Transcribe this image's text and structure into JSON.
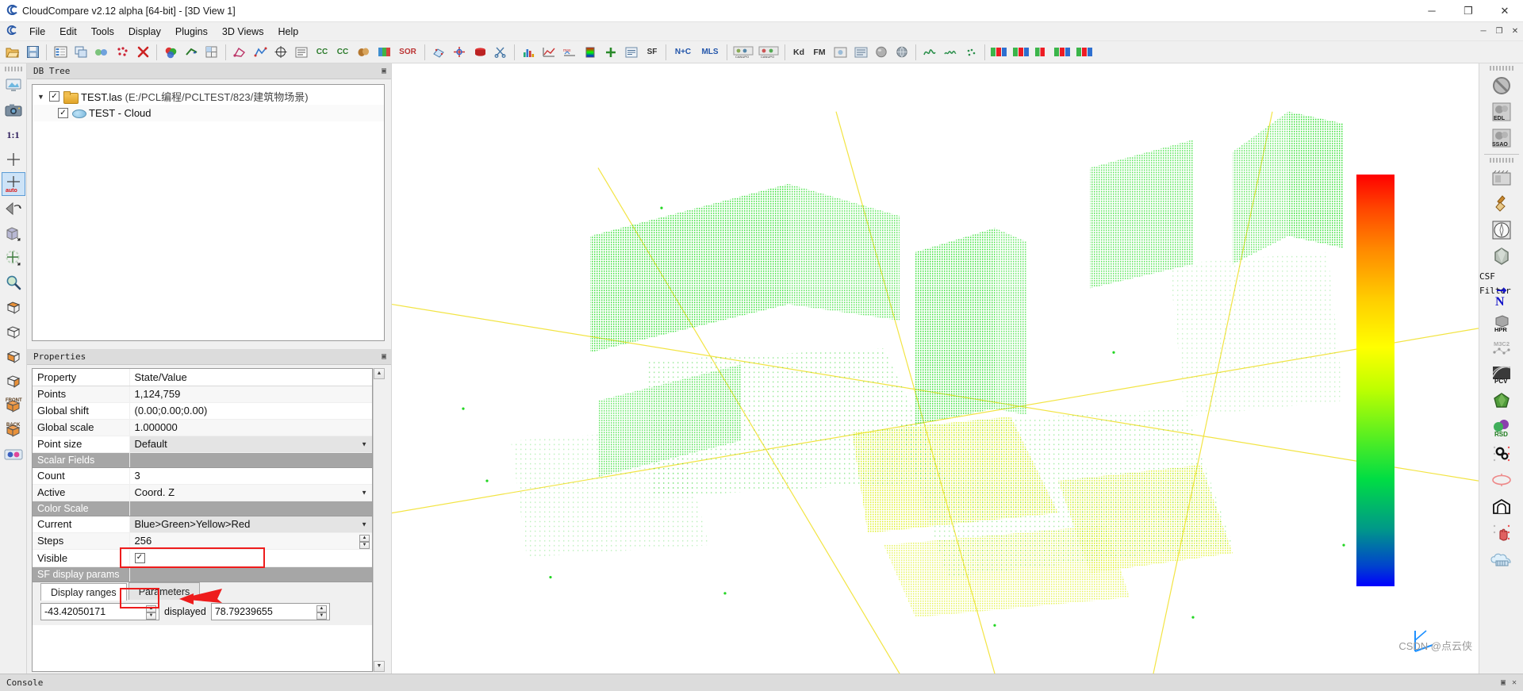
{
  "window": {
    "title": "CloudCompare v2.12 alpha [64-bit] - [3D View 1]",
    "app_icon": "cloudcompare-icon",
    "minimize": "─",
    "maximize": "❐",
    "close": "✕",
    "inner_minimize": "─",
    "inner_restore": "❐",
    "inner_close": "✕"
  },
  "menu": {
    "icon": "cloudcompare-icon",
    "items": [
      {
        "label": "File"
      },
      {
        "label": "Edit"
      },
      {
        "label": "Tools"
      },
      {
        "label": "Display"
      },
      {
        "label": "Plugins"
      },
      {
        "label": "3D Views"
      },
      {
        "label": "Help"
      }
    ]
  },
  "toolbar": {
    "groups": [
      {
        "buttons": [
          {
            "name": "open-file-icon",
            "glyph": "📂"
          },
          {
            "name": "save-file-icon",
            "glyph": "💾"
          }
        ]
      },
      {
        "buttons": [
          {
            "name": "properties-icon",
            "glyph": "☷"
          },
          {
            "name": "clone-icon",
            "glyph": "⧉"
          },
          {
            "name": "merge-icon",
            "glyph": "⬚"
          },
          {
            "name": "subsample-icon",
            "glyph": "⁙"
          },
          {
            "name": "delete-icon",
            "glyph": "✕"
          }
        ]
      },
      {
        "buttons": [
          {
            "name": "colors-icon",
            "glyph": "⬤"
          },
          {
            "name": "normals-icon",
            "glyph": "➦"
          },
          {
            "name": "octree-icon",
            "glyph": "▦"
          }
        ]
      },
      {
        "buttons": [
          {
            "name": "segment-icon",
            "glyph": "✄"
          },
          {
            "name": "trace-polyline-icon",
            "glyph": "⌇"
          },
          {
            "name": "point-picking-icon",
            "glyph": "⌖"
          },
          {
            "name": "point-list-picking-icon",
            "glyph": "≣"
          },
          {
            "name": "cc-compare-icon",
            "glyph": "CC"
          },
          {
            "name": "cc-cloud-icon",
            "glyph": "CC"
          },
          {
            "name": "registration-icon",
            "glyph": "☸"
          },
          {
            "name": "align-icon",
            "glyph": "◩"
          },
          {
            "name": "sor-filter-icon",
            "glyph": "SOR"
          }
        ]
      },
      {
        "buttons": [
          {
            "name": "fit-plane-icon",
            "glyph": "◱"
          },
          {
            "name": "cross-section-icon",
            "glyph": "✠"
          },
          {
            "name": "primitive-factory-icon",
            "glyph": "⬟"
          },
          {
            "name": "scissors-icon",
            "glyph": "✂"
          }
        ]
      },
      {
        "buttons": [
          {
            "name": "histogram-icon",
            "glyph": "📊"
          },
          {
            "name": "plot-icon",
            "glyph": "↗"
          },
          {
            "name": "min-max-icon",
            "glyph": "↕"
          },
          {
            "name": "sf-gradient-icon",
            "glyph": "▤"
          },
          {
            "name": "add-sf-icon",
            "glyph": "＋"
          },
          {
            "name": "sf-arithmetic-icon",
            "glyph": "≡"
          },
          {
            "name": "sf-tool-icon",
            "glyph": "SF"
          }
        ]
      },
      {
        "buttons": [
          {
            "name": "compute-normals-icon",
            "glyph": "N+C"
          },
          {
            "name": "mls-smoothing-icon",
            "glyph": "MLS"
          }
        ]
      },
      {
        "buttons": [
          {
            "name": "canupo-create-icon",
            "glyph": "◰"
          },
          {
            "name": "canupo-classify-icon",
            "glyph": "◳"
          }
        ]
      },
      {
        "buttons": [
          {
            "name": "kd-tree-icon",
            "glyph": "Kd"
          },
          {
            "name": "facets-fm-icon",
            "glyph": "FM"
          },
          {
            "name": "render-to-file-icon",
            "glyph": "🖼"
          },
          {
            "name": "display-settings-icon",
            "glyph": "☰"
          },
          {
            "name": "sphere-icon",
            "glyph": "●"
          },
          {
            "name": "globe-icon",
            "glyph": "◑"
          }
        ]
      },
      {
        "buttons": [
          {
            "name": "curvature-icon",
            "glyph": "∿"
          },
          {
            "name": "roughness-icon",
            "glyph": "≈"
          },
          {
            "name": "density-icon",
            "glyph": "∴"
          }
        ]
      },
      {
        "buttons": [
          {
            "name": "rgb-split-a-icon",
            "glyph": "█"
          },
          {
            "name": "rgb-split-b-icon",
            "glyph": "█"
          },
          {
            "name": "rgb-split-c-icon",
            "glyph": "█"
          },
          {
            "name": "rgb-split-d-icon",
            "glyph": "█"
          },
          {
            "name": "rgb-split-e-icon",
            "glyph": "█"
          }
        ]
      }
    ]
  },
  "left_toolbar": {
    "buttons": [
      {
        "name": "set-global-zoom-icon",
        "glyph": "🖥"
      },
      {
        "name": "snapshot-icon",
        "glyph": "📷"
      },
      {
        "name": "zoom-1-1-icon",
        "glyph": "1:1"
      },
      {
        "name": "pivot-center-icon",
        "glyph": "✢"
      },
      {
        "name": "auto-pivot-icon",
        "glyph": "auto",
        "selected": true
      },
      {
        "name": "flip-view-icon",
        "glyph": "◁"
      },
      {
        "name": "cube-view-icon",
        "glyph": "⬛"
      },
      {
        "name": "translate-rotate-icon",
        "glyph": "✥"
      },
      {
        "name": "zoom-icon",
        "glyph": "🔍"
      },
      {
        "name": "view-top-icon",
        "glyph": "▭"
      },
      {
        "name": "view-bottom-icon",
        "glyph": "▬"
      },
      {
        "name": "view-left-icon",
        "glyph": "▱"
      },
      {
        "name": "view-right-icon",
        "glyph": "▰"
      },
      {
        "name": "view-front-icon",
        "glyph": "FRONT"
      },
      {
        "name": "view-back-icon",
        "glyph": "BACK"
      },
      {
        "name": "stereo-mode-icon",
        "glyph": "◉◉"
      }
    ]
  },
  "right_toolbar": {
    "label": "CSF Filter",
    "buttons_top": [
      {
        "name": "no-shader-icon",
        "glyph": "⊘"
      },
      {
        "name": "edl-shader-icon",
        "glyph": "EDL"
      },
      {
        "name": "ssao-shader-icon",
        "glyph": "SSAO"
      }
    ],
    "buttons_bottom": [
      {
        "name": "animation-icon",
        "glyph": "🎬"
      },
      {
        "name": "broom-icon",
        "glyph": "🧹"
      },
      {
        "name": "compass-icon",
        "glyph": "🧭"
      },
      {
        "name": "csf-filter-icon",
        "glyph": "⬟"
      },
      {
        "name": "north-arrow-icon",
        "glyph": "N"
      },
      {
        "name": "hpr-icon",
        "glyph": "HPR"
      },
      {
        "name": "m3c2-icon",
        "glyph": "M3C2"
      },
      {
        "name": "pcv-icon",
        "glyph": "PCV"
      },
      {
        "name": "poisson-recon-icon",
        "glyph": "⬟"
      },
      {
        "name": "rsd-icon",
        "glyph": "RSD"
      },
      {
        "name": "gears-icon",
        "glyph": "⚙"
      },
      {
        "name": "ellipse-icon",
        "glyph": "⬭"
      },
      {
        "name": "tunnel-icon",
        "glyph": "⌒"
      },
      {
        "name": "hand-icon",
        "glyph": "☝"
      },
      {
        "name": "cloud-layers-icon",
        "glyph": "☁"
      }
    ]
  },
  "db_tree": {
    "title": "DB Tree",
    "float_icon": "undock-icon",
    "nodes": [
      {
        "expander": "▼",
        "checked": "✓",
        "icon": "folder-icon",
        "name": "TEST.las",
        "path": "(E:/PCL编程/PCLTEST/823/建筑物场景)"
      },
      {
        "expander": "",
        "checked": "✓",
        "icon": "point-cloud-icon",
        "name": "TEST - Cloud",
        "path": ""
      }
    ]
  },
  "properties": {
    "title": "Properties",
    "float_icon": "undock-icon",
    "header": {
      "key": "Property",
      "value": "State/Value"
    },
    "rows": [
      {
        "key": "Points",
        "value": "1,124,759",
        "type": "text"
      },
      {
        "key": "Global shift",
        "value": "(0.00;0.00;0.00)",
        "type": "text"
      },
      {
        "key": "Global scale",
        "value": "1.000000",
        "type": "text"
      },
      {
        "key": "Point size",
        "value": "Default",
        "type": "combo"
      },
      {
        "key": "Scalar Fields",
        "value": "",
        "type": "section"
      },
      {
        "key": "Count",
        "value": "3",
        "type": "text"
      },
      {
        "key": "Active",
        "value": "Coord. Z",
        "type": "combo"
      },
      {
        "key": "Color Scale",
        "value": "",
        "type": "section"
      },
      {
        "key": "Current",
        "value": "Blue>Green>Yellow>Red",
        "type": "combo-highlight"
      },
      {
        "key": "Steps",
        "value": "256",
        "type": "spin"
      },
      {
        "key": "Visible",
        "value": "✓",
        "type": "check-highlight"
      },
      {
        "key": "SF display params",
        "value": "",
        "type": "section"
      }
    ],
    "sf_tabs": [
      {
        "label": "Display ranges",
        "active": true
      },
      {
        "label": "Parameters",
        "active": false
      }
    ],
    "display_range": {
      "min": "-43.42050171",
      "mid_label": "displayed",
      "max": "78.79239655",
      "spin_up": "▲",
      "spin_down": "▼"
    },
    "scrollbar": {
      "up": "▲",
      "down": "▼"
    }
  },
  "view3d": {
    "colorbar": {
      "name": "scalar-field-color-scale",
      "gradient": [
        "#ff0000",
        "#ffff00",
        "#00ff00",
        "#0000ff"
      ]
    },
    "axis_gizmo": {
      "name": "axis-origin-gizmo"
    },
    "watermark": "CSDN @点云侠"
  },
  "console": {
    "title": "Console",
    "float_icon": "undock-icon",
    "close_icon": "close-icon"
  },
  "colors": {
    "accent_red": "#ee1c1c",
    "panel_gray": "#f0f0f0",
    "section_gray": "#a6a6a6",
    "selection_blue": "#cde3f7",
    "point_green": "#22dd22"
  }
}
